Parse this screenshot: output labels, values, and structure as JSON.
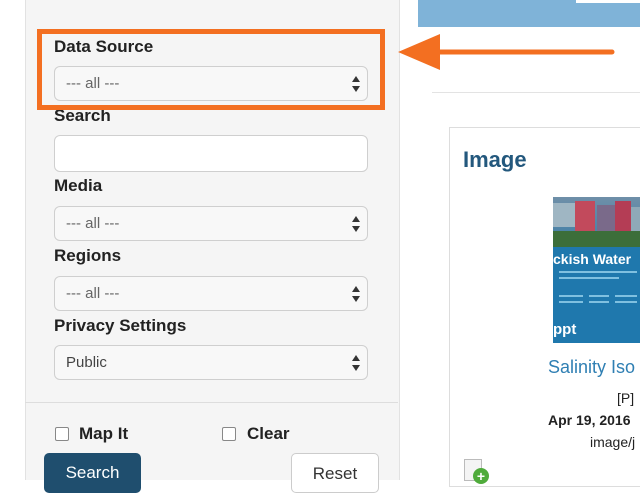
{
  "filters": {
    "data_source": {
      "label": "Data Source",
      "value": "--- all ---"
    },
    "search": {
      "label": "Search",
      "value": ""
    },
    "media": {
      "label": "Media",
      "value": "--- all ---"
    },
    "regions": {
      "label": "Regions",
      "value": "--- all ---"
    },
    "privacy": {
      "label": "Privacy Settings",
      "value": "Public"
    },
    "map_it_label": "Map It",
    "clear_label": "Clear",
    "search_button": "Search",
    "reset_button": "Reset"
  },
  "result_card": {
    "heading": "Image",
    "thumbnail": {
      "title_text": "ckish Water",
      "footer_text": "ppt"
    },
    "link_text": "Salinity Iso",
    "type_badge": "[P]",
    "date": "Apr 19, 2016",
    "mime": "image/j"
  },
  "colors": {
    "highlight": "#f36f21",
    "accent": "#1f4e6e",
    "link": "#2f7fb3",
    "heading": "#23587d"
  }
}
